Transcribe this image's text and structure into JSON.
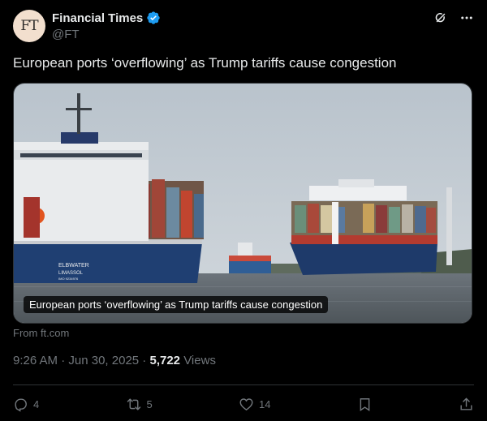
{
  "author": {
    "avatar_text": "FT",
    "name": "Financial Times",
    "handle": "@FT"
  },
  "post": {
    "text": "European ports ‘overflowing’ as Trump tariffs cause congestion"
  },
  "media": {
    "caption": "European ports ‘overflowing’ as Trump tariffs cause congestion",
    "source": "From ft.com",
    "ship_name_line1": "ELBWATER",
    "ship_name_line2": "LIMASSOL",
    "ship_name_line3": "IMO 9234976"
  },
  "meta": {
    "time": "9:26 AM",
    "sep1": " · ",
    "date": "Jun 30, 2025",
    "sep2": " · ",
    "views_count": "5,722",
    "views_label": " Views"
  },
  "actions": {
    "replies": "4",
    "reposts": "5",
    "likes": "14"
  },
  "icons": {
    "verified": "verified-badge-icon",
    "grok": "grok-icon",
    "more": "more-icon",
    "reply": "reply-icon",
    "repost": "repost-icon",
    "like": "heart-icon",
    "bookmark": "bookmark-icon",
    "share": "share-icon"
  },
  "colors": {
    "background": "#000000",
    "text_primary": "#e7e9ea",
    "text_secondary": "#71767b",
    "verified_blue": "#1d9bf0",
    "divider": "#2f3336"
  }
}
